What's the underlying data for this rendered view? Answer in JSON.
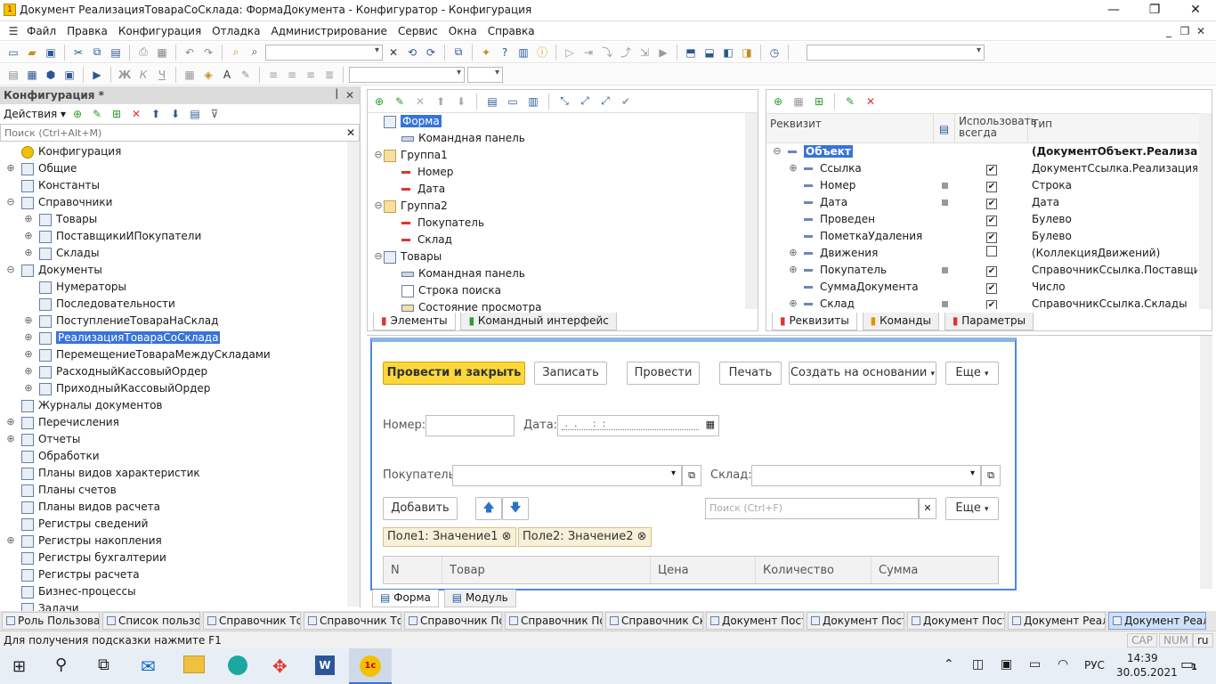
{
  "window": {
    "title": "Документ РеализацияТовараСоСклада: ФормаДокумента - Конфигуратор - Конфигурация",
    "minimize": "—",
    "restore": "❐",
    "close": "✕"
  },
  "menu": [
    "Файл",
    "Правка",
    "Конфигурация",
    "Отладка",
    "Администрирование",
    "Сервис",
    "Окна",
    "Справка"
  ],
  "left_panel": {
    "title": "Конфигурация *",
    "actions_label": "Действия",
    "search_placeholder": "Поиск (Ctrl+Alt+M)",
    "tree": [
      {
        "label": "Конфигурация",
        "level": 0,
        "exp": ""
      },
      {
        "label": "Общие",
        "level": 0,
        "exp": "⊕"
      },
      {
        "label": "Константы",
        "level": 0,
        "exp": ""
      },
      {
        "label": "Справочники",
        "level": 0,
        "exp": "⊖"
      },
      {
        "label": "Товары",
        "level": 1,
        "exp": "⊕"
      },
      {
        "label": "ПоставщикиИПокупатели",
        "level": 1,
        "exp": "⊕"
      },
      {
        "label": "Склады",
        "level": 1,
        "exp": "⊕"
      },
      {
        "label": "Документы",
        "level": 0,
        "exp": "⊖"
      },
      {
        "label": "Нумераторы",
        "level": 1,
        "exp": ""
      },
      {
        "label": "Последовательности",
        "level": 1,
        "exp": ""
      },
      {
        "label": "ПоступлениеТовараНаСклад",
        "level": 1,
        "exp": "⊕"
      },
      {
        "label": "РеализацияТовараСоСклада",
        "level": 1,
        "exp": "⊕",
        "selected": true
      },
      {
        "label": "ПеремещениеТовараМеждуСкладами",
        "level": 1,
        "exp": "⊕"
      },
      {
        "label": "РасходныйКассовыйОрдер",
        "level": 1,
        "exp": "⊕"
      },
      {
        "label": "ПриходныйКассовыйОрдер",
        "level": 1,
        "exp": "⊕"
      },
      {
        "label": "Журналы документов",
        "level": 0,
        "exp": ""
      },
      {
        "label": "Перечисления",
        "level": 0,
        "exp": "⊕"
      },
      {
        "label": "Отчеты",
        "level": 0,
        "exp": "⊕"
      },
      {
        "label": "Обработки",
        "level": 0,
        "exp": ""
      },
      {
        "label": "Планы видов характеристик",
        "level": 0,
        "exp": ""
      },
      {
        "label": "Планы счетов",
        "level": 0,
        "exp": ""
      },
      {
        "label": "Планы видов расчета",
        "level": 0,
        "exp": ""
      },
      {
        "label": "Регистры сведений",
        "level": 0,
        "exp": ""
      },
      {
        "label": "Регистры накопления",
        "level": 0,
        "exp": "⊕"
      },
      {
        "label": "Регистры бухгалтерии",
        "level": 0,
        "exp": ""
      },
      {
        "label": "Регистры расчета",
        "level": 0,
        "exp": ""
      },
      {
        "label": "Бизнес-процессы",
        "level": 0,
        "exp": ""
      },
      {
        "label": "Задачи",
        "level": 0,
        "exp": ""
      }
    ]
  },
  "elements_panel": {
    "tree": [
      {
        "label": "Форма",
        "level": 0,
        "exp": "",
        "selected": true,
        "kind": "form"
      },
      {
        "label": "Командная панель",
        "level": 1,
        "exp": "",
        "kind": "cmd"
      },
      {
        "label": "Группа1",
        "level": 0,
        "exp": "⊖",
        "kind": "folder"
      },
      {
        "label": "Номер",
        "level": 1,
        "exp": "",
        "kind": "red"
      },
      {
        "label": "Дата",
        "level": 1,
        "exp": "",
        "kind": "red"
      },
      {
        "label": "Группа2",
        "level": 0,
        "exp": "⊖",
        "kind": "folder"
      },
      {
        "label": "Покупатель",
        "level": 1,
        "exp": "",
        "kind": "red"
      },
      {
        "label": "Склад",
        "level": 1,
        "exp": "",
        "kind": "red"
      },
      {
        "label": "Товары",
        "level": 0,
        "exp": "⊖",
        "kind": "table"
      },
      {
        "label": "Командная панель",
        "level": 1,
        "exp": "",
        "kind": "cmd"
      },
      {
        "label": "Строка поиска",
        "level": 1,
        "exp": "",
        "kind": "search"
      },
      {
        "label": "Состояние просмотра",
        "level": 1,
        "exp": "",
        "kind": "state"
      }
    ],
    "tabs": [
      "Элементы",
      "Командный интерфейс"
    ]
  },
  "attrs_panel": {
    "headers": [
      "Реквизит",
      "Использовать всегда",
      "Тип"
    ],
    "rows": [
      {
        "name": "Объект",
        "level": 0,
        "exp": "⊖",
        "dot": false,
        "check": "",
        "type": "(ДокументОбъект.Реализаци…",
        "selected": true,
        "bold": true
      },
      {
        "name": "Ссылка",
        "level": 1,
        "exp": "⊕",
        "dot": false,
        "check": "✔",
        "type": "ДокументСсылка.РеализацияТов…"
      },
      {
        "name": "Номер",
        "level": 1,
        "exp": "",
        "dot": true,
        "check": "✔",
        "type": "Строка"
      },
      {
        "name": "Дата",
        "level": 1,
        "exp": "",
        "dot": true,
        "check": "✔",
        "type": "Дата"
      },
      {
        "name": "Проведен",
        "level": 1,
        "exp": "",
        "dot": false,
        "check": "✔",
        "type": "Булево"
      },
      {
        "name": "ПометкаУдаления",
        "level": 1,
        "exp": "",
        "dot": false,
        "check": "✔",
        "type": "Булево"
      },
      {
        "name": "Движения",
        "level": 1,
        "exp": "⊕",
        "dot": false,
        "check": "",
        "type": "(КоллекцияДвижений)"
      },
      {
        "name": "Покупатель",
        "level": 1,
        "exp": "⊕",
        "dot": true,
        "check": "✔",
        "type": "СправочникСсылка.ПоставщикиИ…"
      },
      {
        "name": "СуммаДокумента",
        "level": 1,
        "exp": "",
        "dot": false,
        "check": "✔",
        "type": "Число"
      },
      {
        "name": "Склад",
        "level": 1,
        "exp": "⊕",
        "dot": true,
        "check": "✔",
        "type": "СправочникСсылка.Склады"
      }
    ],
    "tabs": [
      "Реквизиты",
      "Команды",
      "Параметры"
    ]
  },
  "form_preview": {
    "buttons": {
      "post_close": "Провести и закрыть",
      "write": "Записать",
      "post": "Провести",
      "print": "Печать",
      "create_based": "Создать на основании",
      "more": "Еще"
    },
    "number_label": "Номер:",
    "date_label": "Дата:",
    "date_mask": " .  .     :  :",
    "buyer_label": "Покупатель:",
    "warehouse_label": "Склад:",
    "add_button": "Добавить",
    "search_placeholder": "Поиск (Ctrl+F)",
    "more2": "Еще",
    "filters": [
      "Поле1: Значение1",
      "Поле2: Значение2"
    ],
    "columns": [
      "N",
      "Товар",
      "Цена",
      "Количество",
      "Сумма"
    ],
    "tabs": [
      "Форма",
      "Модуль"
    ]
  },
  "window_tabs": [
    "Роль Пользоват…",
    "Список пользов…",
    "Справочник Тов…",
    "Справочник Тов…",
    "Справочник Пос…",
    "Справочник Пос…",
    "Справочник Скл…",
    "Документ Посту…",
    "Документ Посту…",
    "Документ Посту…",
    "Документ Реал…",
    "Документ Реал…"
  ],
  "status": {
    "hint": "Для получения подсказки нажмите F1",
    "cap": "CAP",
    "num": "NUM",
    "lang": "ru"
  },
  "taskbar": {
    "lang": "РУС",
    "time": "14:39",
    "date": "30.05.2021",
    "notif": "1"
  }
}
